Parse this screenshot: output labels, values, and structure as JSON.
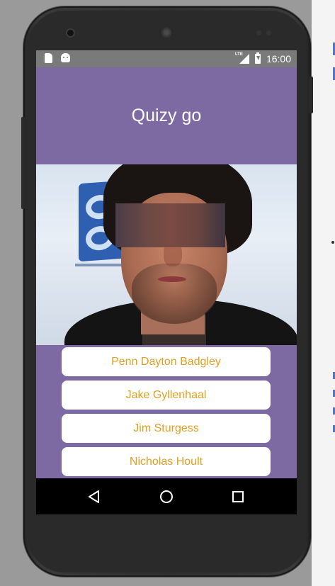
{
  "status_bar": {
    "network_type": "LTE",
    "time": "16:00"
  },
  "app": {
    "title": "Quizy go"
  },
  "quiz": {
    "answers": [
      {
        "label": "Penn Dayton Badgley"
      },
      {
        "label": "Jake Gyllenhaal"
      },
      {
        "label": "Jim Sturgess"
      },
      {
        "label": "Nicholas Hoult"
      }
    ]
  },
  "nav_bar": {
    "buttons": [
      "back-icon",
      "home-icon",
      "recents-icon"
    ]
  },
  "colors": {
    "app_background": "#7e6aa3",
    "answer_text": "#e0a020",
    "answer_button": "#ffffff",
    "status_bar": "#7a7a7a",
    "nav_bar": "#000000"
  }
}
